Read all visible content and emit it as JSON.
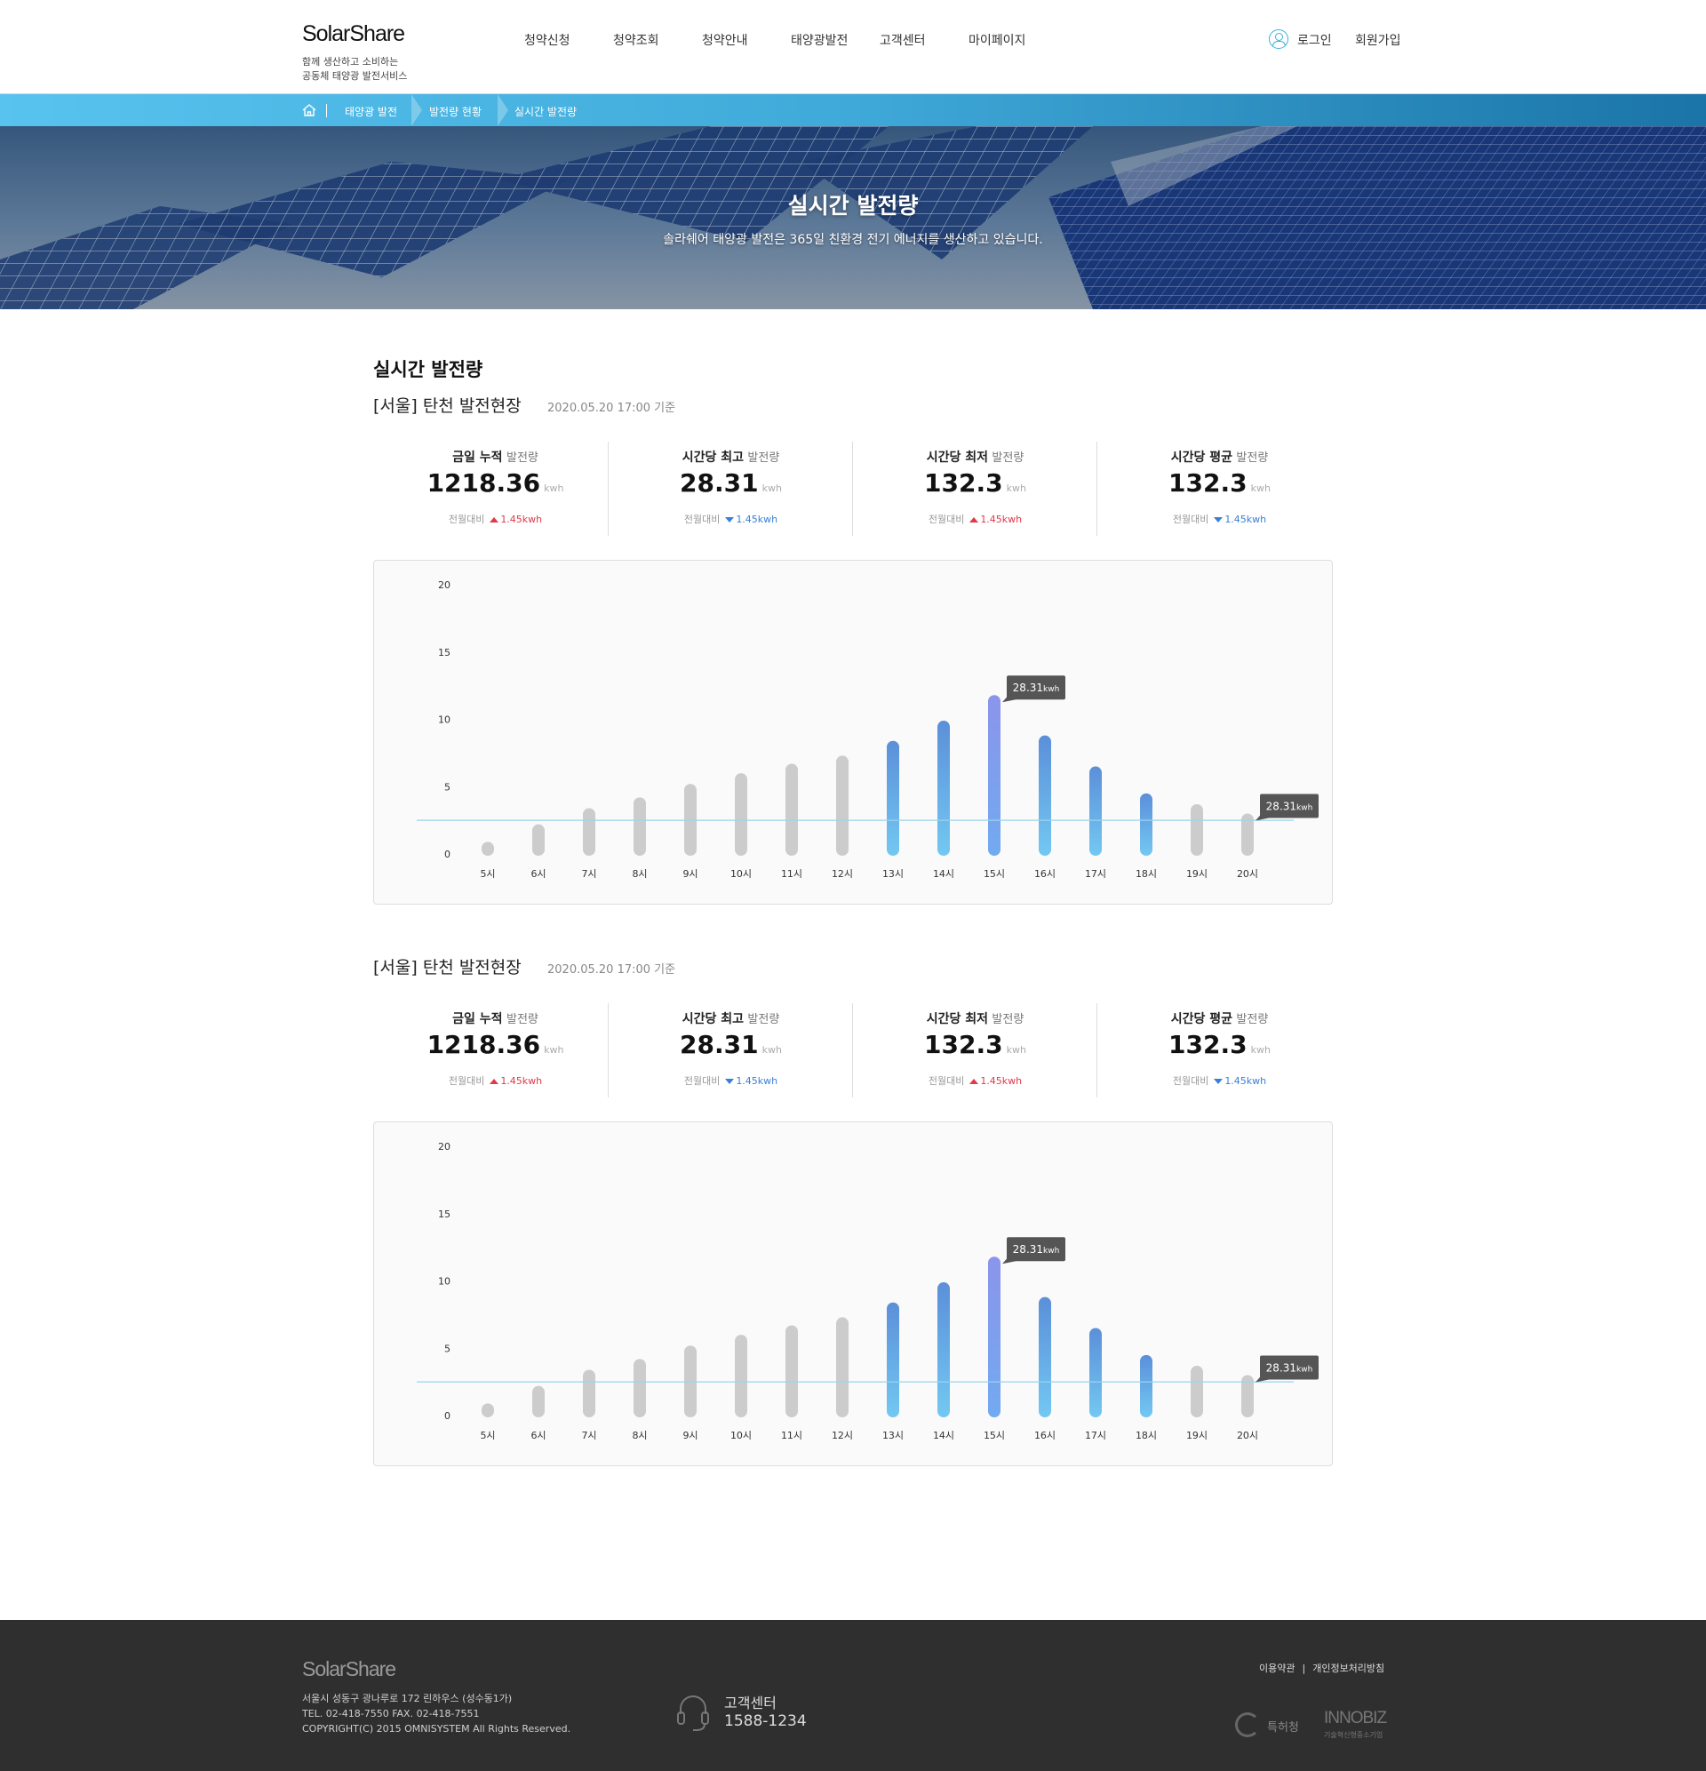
{
  "header": {
    "logo": "SolarShare",
    "tagline_1": "함께 생산하고 소비하는",
    "tagline_2": "공동체 태양광 발전서비스",
    "nav": [
      "청약신청",
      "청약조회",
      "청약안내",
      "태양광발전",
      "고객센터",
      "마이페이지"
    ],
    "login_label": "로그인",
    "signup_label": "회원가입"
  },
  "breadcrumb": [
    "태양광 발전",
    "발전량 현황",
    "실시간 발전량"
  ],
  "hero": {
    "title": "실시간 발전량",
    "subtitle": "솔라쉐어 태양광 발전은 365일 친환경 전기 에너지를 생산하고 있습니다."
  },
  "page_title": "실시간 발전량",
  "sections": [
    {
      "site": "[서울] 탄천 발전현장",
      "timestamp": "2020.05.20 17:00 기준",
      "stats": [
        {
          "label_bold": "금일 누적",
          "label_light": "발전량",
          "value": "1218.36",
          "unit": "kwh",
          "compare_label": "전월대비",
          "direction": "up",
          "delta": "1.45kwh"
        },
        {
          "label_bold": "시간당 최고",
          "label_light": "발전량",
          "value": "28.31",
          "unit": "kwh",
          "compare_label": "전월대비",
          "direction": "down",
          "delta": "1.45kwh"
        },
        {
          "label_bold": "시간당 최저",
          "label_light": "발전량",
          "value": "132.3",
          "unit": "kwh",
          "compare_label": "전월대비",
          "direction": "up",
          "delta": "1.45kwh"
        },
        {
          "label_bold": "시간당 평균",
          "label_light": "발전량",
          "value": "132.3",
          "unit": "kwh",
          "compare_label": "전월대비",
          "direction": "down",
          "delta": "1.45kwh"
        }
      ]
    },
    {
      "site": "[서울] 탄천 발전현장",
      "timestamp": "2020.05.20 17:00 기준",
      "stats": [
        {
          "label_bold": "금일 누적",
          "label_light": "발전량",
          "value": "1218.36",
          "unit": "kwh",
          "compare_label": "전월대비",
          "direction": "up",
          "delta": "1.45kwh"
        },
        {
          "label_bold": "시간당 최고",
          "label_light": "발전량",
          "value": "28.31",
          "unit": "kwh",
          "compare_label": "전월대비",
          "direction": "down",
          "delta": "1.45kwh"
        },
        {
          "label_bold": "시간당 최저",
          "label_light": "발전량",
          "value": "132.3",
          "unit": "kwh",
          "compare_label": "전월대비",
          "direction": "up",
          "delta": "1.45kwh"
        },
        {
          "label_bold": "시간당 평균",
          "label_light": "발전량",
          "value": "132.3",
          "unit": "kwh",
          "compare_label": "전월대비",
          "direction": "down",
          "delta": "1.45kwh"
        }
      ]
    }
  ],
  "chart_data": [
    {
      "type": "bar",
      "categories": [
        "5시",
        "6시",
        "7시",
        "8시",
        "9시",
        "10시",
        "11시",
        "12시",
        "13시",
        "14시",
        "15시",
        "16시",
        "17시",
        "18시",
        "19시",
        "20시"
      ],
      "values": [
        0.9,
        2.2,
        3.4,
        4.2,
        5.2,
        6.0,
        6.7,
        7.3,
        8.4,
        9.9,
        11.8,
        8.8,
        6.5,
        4.5,
        3.7,
        3.0
      ],
      "highlight": [
        "gray",
        "gray",
        "gray",
        "gray",
        "gray",
        "gray",
        "gray",
        "gray",
        "blue",
        "blue",
        "peak",
        "blue",
        "blue",
        "blue",
        "gray",
        "gray"
      ],
      "ylim": [
        0,
        20
      ],
      "yticks": [
        0,
        5,
        10,
        15,
        20
      ],
      "reference_line": 2.5,
      "annotations": [
        {
          "category": "15시",
          "value_text": "28.31",
          "unit": "kwh"
        },
        {
          "category": "20시",
          "value_text": "28.31",
          "unit": "kwh"
        }
      ],
      "colors": {
        "gray": "#cccccc",
        "blue_top": "#5b8fd9",
        "blue_bottom": "#73c8f2",
        "peak_top": "#8b94ec",
        "peak_bottom": "#72aaf0",
        "line": "#9bd3ee",
        "label_bg": "#555555"
      }
    },
    {
      "type": "bar",
      "categories": [
        "5시",
        "6시",
        "7시",
        "8시",
        "9시",
        "10시",
        "11시",
        "12시",
        "13시",
        "14시",
        "15시",
        "16시",
        "17시",
        "18시",
        "19시",
        "20시"
      ],
      "values": [
        0.9,
        2.2,
        3.4,
        4.2,
        5.2,
        6.0,
        6.7,
        7.3,
        8.4,
        9.9,
        11.8,
        8.8,
        6.5,
        4.5,
        3.7,
        3.0
      ],
      "highlight": [
        "gray",
        "gray",
        "gray",
        "gray",
        "gray",
        "gray",
        "gray",
        "gray",
        "blue",
        "blue",
        "peak",
        "blue",
        "blue",
        "blue",
        "gray",
        "gray"
      ],
      "ylim": [
        0,
        20
      ],
      "yticks": [
        0,
        5,
        10,
        15,
        20
      ],
      "reference_line": 2.5,
      "annotations": [
        {
          "category": "15시",
          "value_text": "28.31",
          "unit": "kwh"
        },
        {
          "category": "20시",
          "value_text": "28.31",
          "unit": "kwh"
        }
      ],
      "colors": {
        "gray": "#cccccc",
        "blue_top": "#5b8fd9",
        "blue_bottom": "#73c8f2",
        "peak_top": "#8b94ec",
        "peak_bottom": "#72aaf0",
        "line": "#9bd3ee",
        "label_bg": "#555555"
      }
    }
  ],
  "footer": {
    "logo": "SolarShare",
    "address": "서울시 성동구 광나루로 172 린하우스 (성수동1가)",
    "tel": "TEL. 02-418-7550  FAX. 02-418-7551",
    "copyright": "COPYRIGHT(C) 2015 OMNISYSTEM All Rights Reserved.",
    "cs_label": "고객센터",
    "cs_number": "1588-1234",
    "links": [
      "이용약관",
      "개인정보처리방침"
    ],
    "badge_1": "특허청",
    "badge_2": "INNOBIZ",
    "badge_2_sub": "기술혁신형중소기업"
  }
}
